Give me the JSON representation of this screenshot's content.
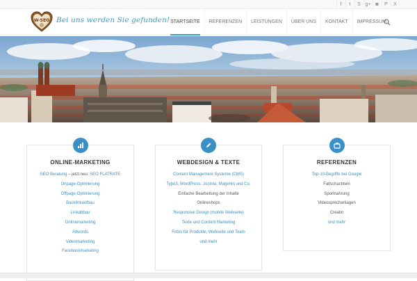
{
  "social": {
    "items": [
      {
        "name": "facebook-icon",
        "glyph": "f"
      },
      {
        "name": "twitter-icon",
        "glyph": "t"
      },
      {
        "name": "skype-icon",
        "glyph": "S"
      },
      {
        "name": "google-plus-icon",
        "glyph": "g+"
      },
      {
        "name": "instagram-icon",
        "glyph": "◙"
      },
      {
        "name": "pinterest-icon",
        "glyph": "P"
      },
      {
        "name": "xing-icon",
        "glyph": "X"
      }
    ]
  },
  "header": {
    "logo_text": "W-SEO",
    "slogan": "Bei uns werden Sie gefunden!",
    "nav": [
      "STARTSEITE",
      "REFERENZEN",
      "LEISTUNGEN",
      "ÜBER UNS",
      "KONTAKT",
      "IMPRESSUM"
    ],
    "active_nav": "STARTSEITE"
  },
  "cards": [
    {
      "icon": "bar-chart-icon",
      "title": "ONLINE-MARKETING",
      "first_line": {
        "a": "SEO Beratung",
        "b": " – jetzt neu: ",
        "c": "SEO FLATRATE"
      },
      "items": [
        {
          "text": "Onpage-Optimierung",
          "link": true
        },
        {
          "text": "Offpage-Optimierung",
          "link": true
        },
        {
          "text": "Backlinkaufbau",
          "link": true
        },
        {
          "text": "Linkabbau",
          "link": true
        },
        {
          "text": "Onlinemarketing",
          "link": true
        },
        {
          "text": "Adwords",
          "link": true
        },
        {
          "text": "Videomarketing",
          "link": true
        },
        {
          "text": "Facebookmarketing",
          "link": true
        }
      ]
    },
    {
      "icon": "pencil-icon",
      "title": "WEBDESIGN & TEXTE",
      "items": [
        {
          "text": "Content Management Systeme (CMS)",
          "link": true
        },
        {
          "text": "Typo3, WordPress, Joomla, Magento und Co.",
          "link": true
        },
        {
          "text": "Einfache Bearbeitung der Inhalte",
          "link": false
        },
        {
          "text": "Onlineshops",
          "link": false
        },
        {
          "text": "Responsive Design (mobile Webseite)",
          "link": true
        },
        {
          "text": "Texte und Content Marketing",
          "link": true
        },
        {
          "text": "Fotos für Produkte, Webseite und Team",
          "link": true
        },
        {
          "text": "und mehr",
          "link": true
        }
      ]
    },
    {
      "icon": "briefcase-icon",
      "title": "REFERENZEN",
      "items": [
        {
          "text": "Top-10-Begriffe bei Google",
          "link": true
        },
        {
          "text": "Faltschachteln",
          "link": false
        },
        {
          "text": "Sportnahrung",
          "link": false
        },
        {
          "text": "Videosprechanlagen",
          "link": false
        },
        {
          "text": "Creatin",
          "link": false
        },
        {
          "text": "und mehr",
          "link": true
        }
      ]
    }
  ],
  "colors": {
    "accent": "#3a8fc4",
    "slogan": "#3a9bc5",
    "logo_brown": "#8b5a2b"
  }
}
